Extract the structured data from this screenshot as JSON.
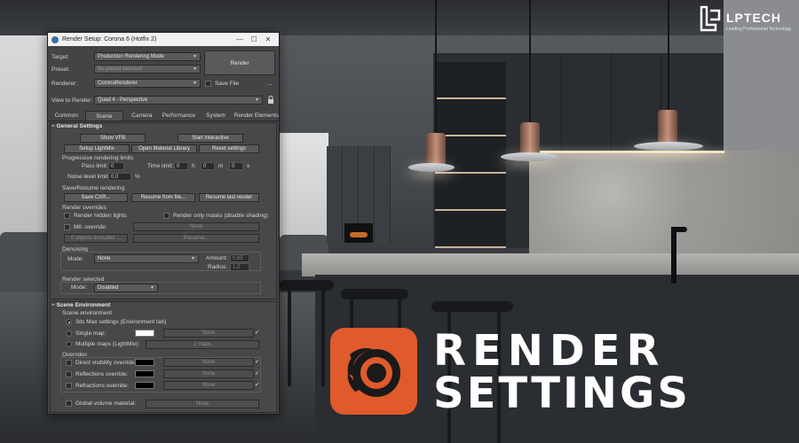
{
  "brand": {
    "name": "LPTECH",
    "tagline": "Leading Professional Technology"
  },
  "headline": {
    "line1": "RENDER",
    "line2": "SETTINGS"
  },
  "colors": {
    "corona_orange": "#e05a2c",
    "dialog_bg": "#444444",
    "titlebar_bg": "#f1f1f1"
  },
  "dialog": {
    "title": "Render Setup: Corona 6 (Hotfix 2)",
    "window_buttons": {
      "minimize": "—",
      "maximize": "☐",
      "close": "✕"
    },
    "target": {
      "label": "Target:",
      "value": "Production Rendering Mode"
    },
    "preset": {
      "label": "Preset:",
      "value": "No preset selected"
    },
    "renderer": {
      "label": "Renderer:",
      "value": "CoronaRenderer"
    },
    "save_file": {
      "label": "Save File",
      "more": "..."
    },
    "view_to_render": {
      "label": "View to Render:",
      "value": "Quad 4 - Perspective"
    },
    "render_button": "Render",
    "tabs": [
      "Common",
      "Scene",
      "Camera",
      "Performance",
      "System",
      "Render Elements"
    ],
    "active_tab": "Scene",
    "general": {
      "title": "General Settings",
      "buttons": {
        "show_vfb": "Show VFB",
        "start_interactive": "Start interactive",
        "setup_lightmix": "Setup LightMix",
        "open_material_library": "Open Material Library",
        "reset_settings": "Reset settings"
      },
      "progressive": {
        "title": "Progressive rendering limits",
        "pass_limit": {
          "label": "Pass limit:",
          "value": "0"
        },
        "time_limit": {
          "label": "Time limit:",
          "h": "0",
          "h_unit": "h",
          "m": "0",
          "m_unit": "m",
          "s": "0",
          "s_unit": "s"
        },
        "noise_limit": {
          "label": "Noise level limit:",
          "value": "0,0",
          "unit": "%"
        }
      },
      "save_resume": {
        "title": "Save/Resume rendering",
        "save_cxr": "Save CXR...",
        "resume_from_file": "Resume from file...",
        "resume_last_render": "Resume last render"
      },
      "overrides": {
        "title": "Render overrides",
        "render_hidden_lights": "Render hidden lights",
        "render_only_masks": "Render only masks (disable shading)",
        "mtl_override": "Mtl. override:",
        "mtl_override_value": "None",
        "objects_excluded": "0 objects excluded ...",
        "preserve": "Preserve..."
      },
      "denoising": {
        "title": "Denoising",
        "mode_label": "Mode:",
        "mode_value": "None",
        "amount_label": "Amount:",
        "amount_value": "0,65",
        "radius_label": "Radius:",
        "radius_value": "1,0"
      },
      "render_selected": {
        "title": "Render selected",
        "mode_label": "Mode:",
        "mode_value": "Disabled"
      }
    },
    "environment": {
      "title": "Scene Environment",
      "scene_env_label": "Scene environment",
      "max_settings": "3ds Max settings (Environment tab)",
      "single_map": "Single map:",
      "single_map_value": "None",
      "multiple_maps": "Multiple maps (LightMix):",
      "multiple_maps_value": "2 maps",
      "overrides_title": "Overrides",
      "direct_visibility": "Direct visibility override:",
      "reflections": "Reflections override:",
      "refractions": "Refractions override:",
      "override_value": "None",
      "global_volume": "Global volume material:",
      "global_volume_value": "None"
    }
  }
}
